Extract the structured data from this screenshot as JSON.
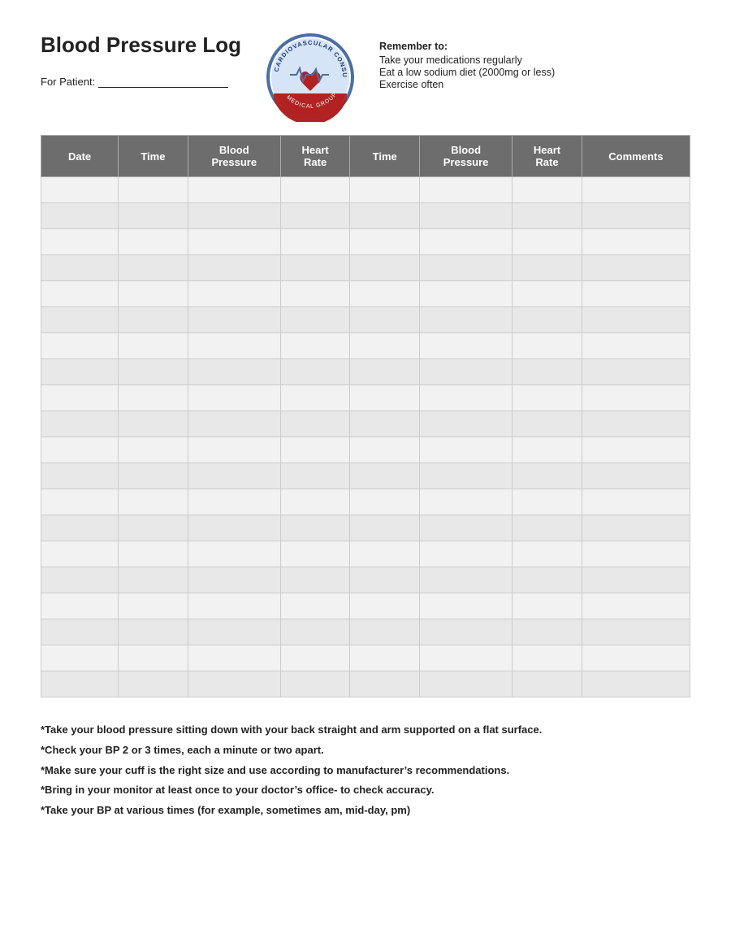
{
  "header": {
    "title": "Blood Pressure Log",
    "patient_label": "For Patient:",
    "logo_alt": "Cardiovascular Consultants Medical Group logo"
  },
  "remember": {
    "title": "Remember to:",
    "items": [
      "Take your medications regularly",
      "Eat a low sodium diet (2000mg or less)",
      "Exercise often"
    ]
  },
  "table": {
    "columns": [
      {
        "id": "date",
        "label": "Date"
      },
      {
        "id": "time1",
        "label": "Time"
      },
      {
        "id": "bp1",
        "label": "Blood\nPressure"
      },
      {
        "id": "hr1",
        "label": "Heart\nRate"
      },
      {
        "id": "time2",
        "label": "Time"
      },
      {
        "id": "bp2",
        "label": "Blood\nPressure"
      },
      {
        "id": "hr2",
        "label": "Heart\nRate"
      },
      {
        "id": "comments",
        "label": "Comments"
      }
    ],
    "row_count": 20
  },
  "footer": {
    "notes": [
      "*Take your blood pressure sitting down with your back straight and arm supported on a flat surface.",
      "*Check your BP 2 or 3 times, each a minute or two apart.",
      "*Make sure your cuff is the right size and use according to manufacturer’s recommendations.",
      "*Bring in your monitor at least once to your doctor’s office- to check accuracy.",
      "*Take your BP at various times (for example, sometimes am, mid-day, pm)"
    ]
  }
}
